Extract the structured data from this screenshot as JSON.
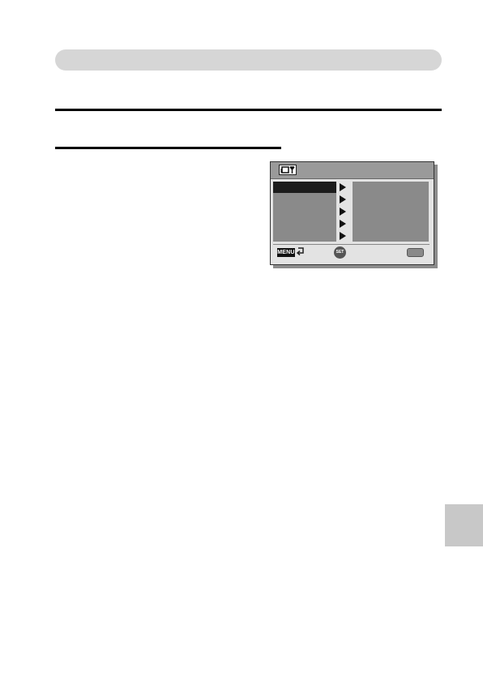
{
  "camera_screen": {
    "menu_items_count_note": "",
    "footer": {
      "menu_key_label": "MENU",
      "set_key_label": "SET"
    }
  }
}
